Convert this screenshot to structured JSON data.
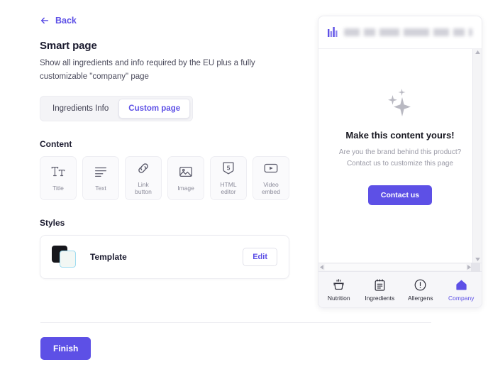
{
  "back": {
    "label": "Back",
    "icon": "arrow-left-icon"
  },
  "header": {
    "title": "Smart page",
    "subtitle": "Show all ingredients and info required by the EU plus a fully customizable \"company\" page"
  },
  "tabs": [
    {
      "label": "Ingredients Info",
      "active": false
    },
    {
      "label": "Custom page",
      "active": true
    }
  ],
  "content": {
    "label": "Content",
    "blocks": [
      {
        "label": "Title",
        "icon": "title-icon"
      },
      {
        "label": "Text",
        "icon": "text-lines-icon"
      },
      {
        "label": "Link\nbutton",
        "icon": "link-icon"
      },
      {
        "label": "Image",
        "icon": "image-icon"
      },
      {
        "label": "HTML\neditor",
        "icon": "html5-icon"
      },
      {
        "label": "Video\nembed",
        "icon": "video-play-icon"
      }
    ]
  },
  "styles": {
    "label": "Styles",
    "template": {
      "name": "Template",
      "edit_label": "Edit",
      "swatch_back_color": "#17171c",
      "swatch_front_color": "#f2f7f4",
      "swatch_front_border": "#9fdcf0"
    }
  },
  "footer": {
    "finish_label": "Finish"
  },
  "preview": {
    "header": {
      "logo": "bar-chart-logo-icon",
      "title_blurred": true
    },
    "body": {
      "icon": "sparkles-icon",
      "headline": "Make this content yours!",
      "subtitle_line1": "Are you the brand behind this product?",
      "subtitle_line2": "Contact us to customize this page",
      "cta_label": "Contact us"
    },
    "nav": [
      {
        "label": "Nutrition",
        "icon": "cooking-pot-icon",
        "active": false
      },
      {
        "label": "Ingredients",
        "icon": "notepad-icon",
        "active": false
      },
      {
        "label": "Allergens",
        "icon": "exclamation-circle-icon",
        "active": false
      },
      {
        "label": "Company",
        "icon": "home-icon",
        "active": true
      }
    ]
  },
  "colors": {
    "accent": "#5d50e6",
    "text": "#1a1a2e",
    "muted": "#8a8a99"
  }
}
